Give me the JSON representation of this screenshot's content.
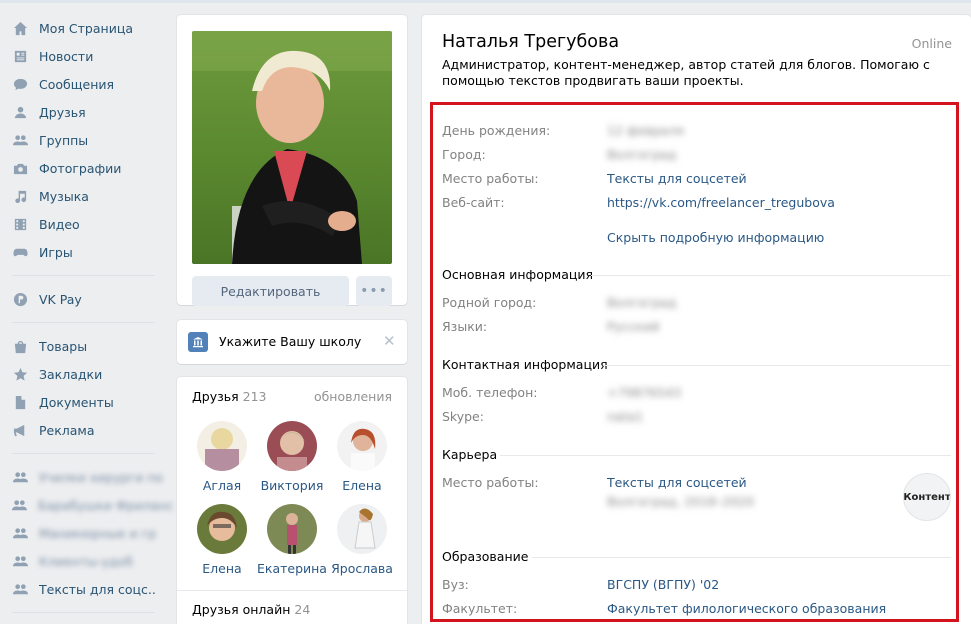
{
  "sidebar": {
    "items": [
      {
        "label": "Моя Страница",
        "icon": "home-icon"
      },
      {
        "label": "Новости",
        "icon": "news-icon"
      },
      {
        "label": "Сообщения",
        "icon": "messages-icon"
      },
      {
        "label": "Друзья",
        "icon": "friends-icon"
      },
      {
        "label": "Группы",
        "icon": "groups-icon"
      },
      {
        "label": "Фотографии",
        "icon": "camera-icon"
      },
      {
        "label": "Музыка",
        "icon": "music-icon"
      },
      {
        "label": "Видео",
        "icon": "video-icon"
      },
      {
        "label": "Игры",
        "icon": "gamepad-icon"
      }
    ],
    "pay": {
      "label": "VK Pay",
      "icon": "vkpay-icon"
    },
    "items2": [
      {
        "label": "Товары",
        "icon": "bag-icon"
      },
      {
        "label": "Закладки",
        "icon": "star-icon"
      },
      {
        "label": "Документы",
        "icon": "document-icon"
      },
      {
        "label": "Реклама",
        "icon": "megaphone-icon"
      }
    ],
    "communities": [
      {
        "label": "Училки хирурги по",
        "icon": "community-icon"
      },
      {
        "label": "Барабушки Фриланс",
        "icon": "community-icon"
      },
      {
        "label": "Маникюрные и гр",
        "icon": "community-icon"
      },
      {
        "label": "Клиенты-удоб",
        "icon": "community-icon"
      },
      {
        "label": "Тексты для соцс..",
        "icon": "community-icon"
      }
    ]
  },
  "avatar_card": {
    "edit_label": "Редактировать",
    "more_label": "•••"
  },
  "school_card": {
    "text": "Укажите Вашу школу",
    "close": "✕"
  },
  "friends": {
    "title": "Друзья",
    "count": "213",
    "updates": "обновления",
    "list": [
      {
        "name": "Аглая"
      },
      {
        "name": "Виктория"
      },
      {
        "name": "Елена"
      },
      {
        "name": "Елена"
      },
      {
        "name": "Екатерина"
      },
      {
        "name": "Ярослава"
      }
    ],
    "online_title": "Друзья онлайн",
    "online_count": "24"
  },
  "profile": {
    "name": "Наталья Трегубова",
    "online": "Online",
    "status": "Администратор, контент-менеджер, автор статей для блогов. Помогаю с помощью текстов продвигать ваши проекты.",
    "rows_top": [
      {
        "key": "День рождения:",
        "value": "12 февраля",
        "blur": true
      },
      {
        "key": "Город:",
        "value": "Волгоград",
        "blur": true
      },
      {
        "key": "Место работы:",
        "value": "Тексты для соцсетей",
        "blur": false
      },
      {
        "key": "Веб-сайт:",
        "value": "https://vk.com/freelancer_tregubova",
        "blur": false
      }
    ],
    "hide_link": "Скрыть подробную информацию",
    "section_main": "Основная информация",
    "rows_main": [
      {
        "key": "Родной город:",
        "value": "Волгоград",
        "blur": true
      },
      {
        "key": "Языки:",
        "value": "Русский",
        "blur": true
      }
    ],
    "section_contact": "Контактная информация",
    "rows_contact": [
      {
        "key": "Моб. телефон:",
        "value": "+79876543",
        "blur": true
      },
      {
        "key": "Skype:",
        "value": "nata1",
        "blur": true
      }
    ],
    "section_career": "Карьера",
    "career": {
      "key": "Место работы:",
      "value": "Тексты для соцсетей",
      "sub": "Волгоград, 2018–2020",
      "badge": "Контент"
    },
    "section_edu": "Образование",
    "rows_edu": [
      {
        "key": "Вуз:",
        "value": "ВГСПУ (ВГПУ) '02",
        "blur": false
      },
      {
        "key": "Факультет:",
        "value": "Факультет филологического образования",
        "blur": false
      }
    ]
  },
  "colors": {
    "link": "#2a5885",
    "highlight": "#d3141c",
    "background": "#edeef0",
    "accent": "#5181b8"
  }
}
